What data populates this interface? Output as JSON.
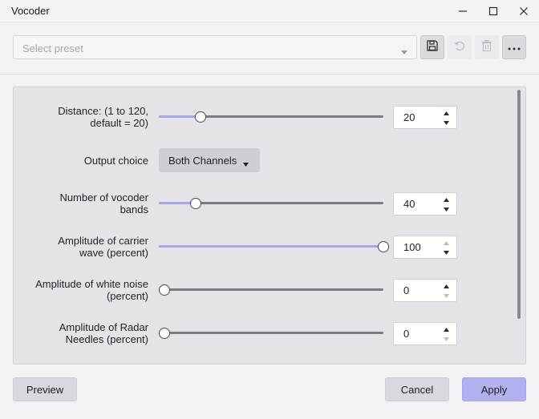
{
  "window": {
    "title": "Vocoder",
    "controls": [
      "minimize-icon",
      "maximize-icon",
      "close-icon"
    ]
  },
  "preset": {
    "placeholder": "Select preset",
    "buttons": [
      {
        "name": "save",
        "icon": "save-icon",
        "enabled": true
      },
      {
        "name": "undo",
        "icon": "undo-icon",
        "enabled": false
      },
      {
        "name": "delete",
        "icon": "trash-icon",
        "enabled": false
      },
      {
        "name": "more",
        "icon": "more-icon",
        "label": "···",
        "enabled": true
      }
    ]
  },
  "controls": {
    "distance": {
      "label_line1": "Distance: (1 to 120,",
      "label_line2": "default = 20)",
      "value": "20",
      "min": 1,
      "max": 120,
      "fraction": 0.165
    },
    "output_choice": {
      "label": "Output choice",
      "selected": "Both Channels"
    },
    "bands": {
      "label_line1": "Number of vocoder",
      "label_line2": "bands",
      "value": "40",
      "fraction": 0.143
    },
    "carrier": {
      "label_line1": "Amplitude of carrier",
      "label_line2": "wave (percent)",
      "value": "100",
      "fraction": 1.0
    },
    "white_noise": {
      "label_line1": "Amplitude of white noise",
      "label_line2": "(percent)",
      "value": "0",
      "fraction": 0.0
    },
    "radar": {
      "label_line1": "Amplitude of Radar",
      "label_line2": "Needles (percent)",
      "value": "0",
      "fraction": 0.0
    }
  },
  "footer": {
    "preview_label": "Preview",
    "cancel_label": "Cancel",
    "apply_label": "Apply"
  },
  "colors": {
    "accent": "#a9a5e8",
    "primary_button": "#b3b0ef",
    "panel": "#e4e3e8"
  }
}
